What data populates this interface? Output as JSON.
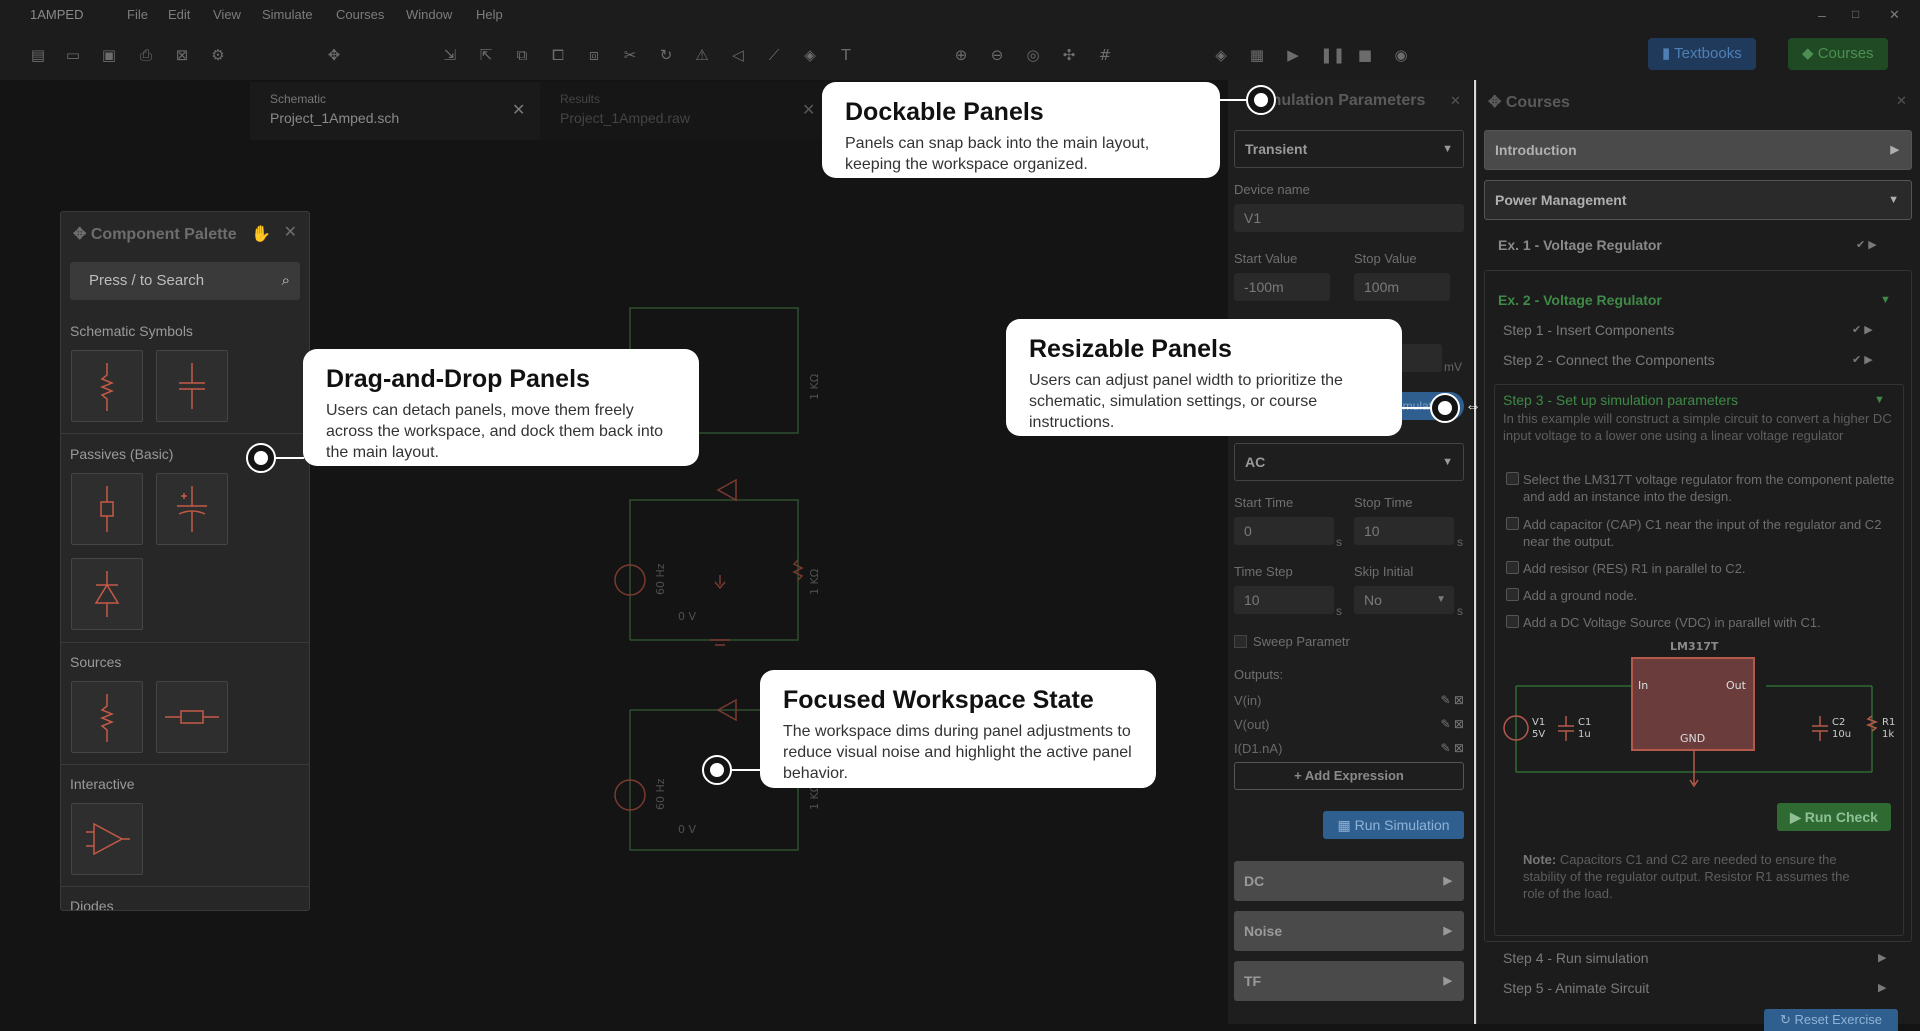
{
  "app": {
    "title": "1AMPED",
    "menu": [
      "File",
      "Edit",
      "View",
      "Simulate",
      "Courses",
      "Window",
      "Help"
    ],
    "buttons": {
      "textbooks": "Textbooks",
      "courses": "Courses"
    },
    "window_controls": [
      "–",
      "□",
      "✕"
    ],
    "colors": {
      "textbooks_btn": "#203a5c",
      "courses_btn": "#1f4a24",
      "accent_green": "#4caf50",
      "wire_green": "#3c7a3c",
      "component_red": "#c45a45",
      "run_sim": "#2f5f8f"
    }
  },
  "toolbar_icons": [
    "new-file-icon",
    "open-folder-icon",
    "save-icon",
    "print-icon",
    "close-file-icon",
    "settings-icon",
    "move-icon",
    "import-icon",
    "export-icon",
    "copy-icon",
    "paste-icon",
    "duplicate-icon",
    "cut-icon",
    "redo-icon",
    "warning-icon",
    "flip-icon",
    "wire-icon",
    "probe-icon",
    "text-icon",
    "zoom-in-icon",
    "zoom-out-icon",
    "zoom-fit-icon",
    "pan-icon",
    "grid-icon",
    "component-icon",
    "graph-icon",
    "play-icon",
    "pause-icon",
    "stop-icon",
    "visibility-icon"
  ],
  "tabs": [
    {
      "label": "Schematic",
      "file": "Project_1Amped.sch"
    },
    {
      "label": "Results",
      "file": "Project_1Amped.raw"
    }
  ],
  "palette": {
    "title": "Component Palette",
    "search_placeholder": "Press / to Search",
    "sections": [
      "Schematic Symbols",
      "Passives (Basic)",
      "Sources",
      "Interactive",
      "Diodes"
    ]
  },
  "schematic": {
    "labels": {
      "r_top": "1 KΩ",
      "freq1": "60 Hz",
      "r_mid": "1 KΩ",
      "gnd1": "0 V",
      "freq2": "60 Hz",
      "r_bot": "1 KΩ",
      "gnd2": "0 V"
    }
  },
  "sim": {
    "title": "Simulation Parameters",
    "analysis": "Transient",
    "device_name_label": "Device name",
    "device_name": "V1",
    "start_value_label": "Start Value",
    "start_value": "-100m",
    "stop_value_label": "Stop Value",
    "stop_value": "100m",
    "unit_mv": "mV",
    "toggle_label": "Simulation",
    "ac_select": "AC",
    "start_time_label": "Start Time",
    "start_time": "0",
    "stop_time_label": "Stop Time",
    "stop_time": "10",
    "time_step_label": "Time Step",
    "time_step": "10",
    "skip_initial_label": "Skip Initial",
    "skip_initial": "No",
    "unit_s": "s",
    "sweep_label": "Sweep Parametr",
    "outputs_label": "Outputs:",
    "outputs": [
      "V(in)",
      "V(out)",
      "I(D1.nA)"
    ],
    "add_expression": "+ Add Expression",
    "run_simulation": "Run Simulation",
    "sections": [
      "DC",
      "Noise",
      "TF"
    ]
  },
  "courses": {
    "title": "Courses",
    "sections": {
      "intro": "Introduction",
      "power": "Power Management"
    },
    "ex1": "Ex. 1 - Voltage Regulator",
    "ex2": "Ex. 2 - Voltage Regulator",
    "step1": "Step 1 - Insert Components",
    "step2": "Step 2 - Connect the Components",
    "step3": "Step 3 - Set up simulation parameters",
    "step3_desc": "In this example will construct a simple circuit to convert a higher DC input voltage to a lower one using a linear voltage regulator",
    "tasks": [
      "Select the LM317T voltage regulator from the component palette and add an instance into the design.",
      "Add capacitor (CAP) C1 near the input of the regulator and C2 near the output.",
      "Add resisor (RES) R1 in parallel to C2.",
      "Add a ground node.",
      "Add a DC Voltage Source (VDC) in parallel with C1."
    ],
    "circuit": {
      "chip": "LM317T",
      "pin_in": "In",
      "pin_out": "Out",
      "pin_gnd": "GND",
      "v1": "V1",
      "v1v": "5V",
      "c1": "C1",
      "c1v": "1u",
      "c2": "C2",
      "c2v": "10u",
      "r1": "R1",
      "r1v": "1k"
    },
    "run_check": "Run Check",
    "note_bold": "Note:",
    "note": "Capacitors C1 and C2 are needed to ensure the stability of the regulator output. Resistor R1 assumes the role of the load.",
    "step4": "Step 4 - Run simulation",
    "step5": "Step 5 - Animate Sircuit",
    "reset": "Reset Exercise"
  },
  "callouts": {
    "dockable": {
      "title": "Dockable Panels",
      "body": "Panels can snap back into the main layout, keeping the workspace organized."
    },
    "drag": {
      "title": "Drag-and-Drop Panels",
      "body": "Users can detach panels, move them freely across the workspace, and dock them back into the main layout."
    },
    "resizable": {
      "title": "Resizable Panels",
      "body": "Users can adjust panel width to prioritize the schematic, simulation settings, or course instructions."
    },
    "focused": {
      "title": "Focused Workspace State",
      "body": "The workspace dims during panel adjustments to reduce visual noise and highlight the active panel behavior."
    }
  }
}
